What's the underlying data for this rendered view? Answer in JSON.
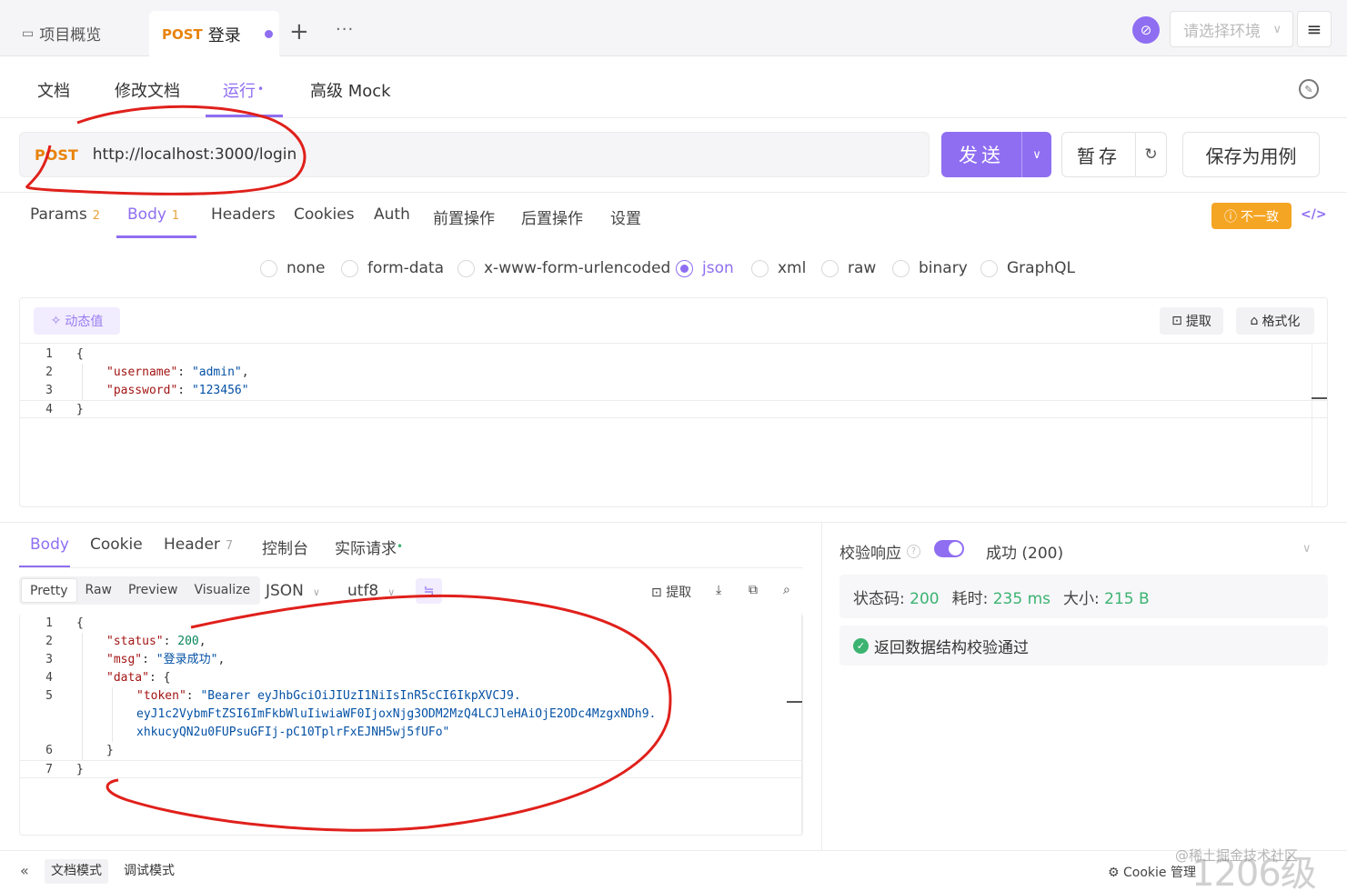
{
  "topbar": {
    "overview_tab": "项目概览",
    "active_tab": {
      "method": "POST",
      "title": "登录"
    },
    "plus": "+",
    "more": "···",
    "env_placeholder": "请选择环境"
  },
  "doc_tabs": [
    {
      "label": "文档"
    },
    {
      "label": "修改文档"
    },
    {
      "label": "运行",
      "dot": "•"
    },
    {
      "label": "高级 Mock"
    }
  ],
  "url": {
    "method": "POST",
    "value": "http://localhost:3000/login"
  },
  "actions": {
    "send": "发送",
    "save": "暂存",
    "save_as_case": "保存为用例"
  },
  "param_tabs": [
    {
      "label": "Params",
      "count": "2"
    },
    {
      "label": "Body",
      "count": "1"
    },
    {
      "label": "Headers"
    },
    {
      "label": "Cookies"
    },
    {
      "label": "Auth"
    },
    {
      "label": "前置操作"
    },
    {
      "label": "后置操作"
    },
    {
      "label": "设置"
    }
  ],
  "diff_badge": "不一致",
  "code_toggle": "</>",
  "body_types": [
    "none",
    "form-data",
    "x-www-form-urlencoded",
    "json",
    "xml",
    "raw",
    "binary",
    "GraphQL"
  ],
  "selected_body_type": "json",
  "request_editor": {
    "dynamic_value": "动态值",
    "extract": "提取",
    "format": "格式化",
    "line_numbers": [
      "1",
      "2",
      "3",
      "4"
    ],
    "lines": {
      "l1": "{",
      "l2_key": "\"username\"",
      "l2_val": "\"admin\"",
      "l3_key": "\"password\"",
      "l3_val": "\"123456\"",
      "l4": "}"
    }
  },
  "response_tabs": [
    {
      "label": "Body"
    },
    {
      "label": "Cookie"
    },
    {
      "label": "Header",
      "count": "7"
    },
    {
      "label": "控制台"
    },
    {
      "label": "实际请求",
      "dot": "•"
    }
  ],
  "view_modes": [
    "Pretty",
    "Raw",
    "Preview",
    "Visualize"
  ],
  "format_select": "JSON",
  "encoding_select": "utf8",
  "response_tools": {
    "extract": "提取"
  },
  "response_body": {
    "line_numbers": [
      "1",
      "2",
      "3",
      "4",
      "5",
      "",
      "",
      "6",
      "7"
    ],
    "l1": "{",
    "status_key": "\"status\"",
    "status_val": "200",
    "msg_key": "\"msg\"",
    "msg_val": "\"登录成功\"",
    "data_key": "\"data\"",
    "data_open": "{",
    "token_key": "\"token\"",
    "token_val_1": "\"Bearer eyJhbGciOiJIUzI1NiIsInR5cCI6IkpXVCJ9.",
    "token_val_2": "eyJ1c2VybmFtZSI6ImFkbWluIiwiaWF0IjoxNjg3ODM2MzQ4LCJleHAiOjE2ODc4MzgxNDh9.",
    "token_val_3": "xhkucyQN2u0FUPsuGFIj-pC10TplrFxEJNH5wj5fUFo\"",
    "data_close": "}",
    "l7": "}"
  },
  "validation": {
    "label": "校验响应",
    "result": "成功 (200)",
    "status_label": "状态码:",
    "status_value": "200",
    "time_label": "耗时:",
    "time_value": "235 ms",
    "size_label": "大小:",
    "size_value": "215 B",
    "schema_ok": "返回数据结构校验通过"
  },
  "bottombar": {
    "doc_mode": "文档模式",
    "debug_mode": "调试模式",
    "cookie_manage": "Cookie 管理",
    "watermark": "@稀土掘金技术社区",
    "watermark_big": "1206级"
  },
  "colors": {
    "accent": "#8f6ef2",
    "method": "#e8830c",
    "success": "#3cb371",
    "warning": "#f5a524",
    "annotation": "#e0201b"
  }
}
